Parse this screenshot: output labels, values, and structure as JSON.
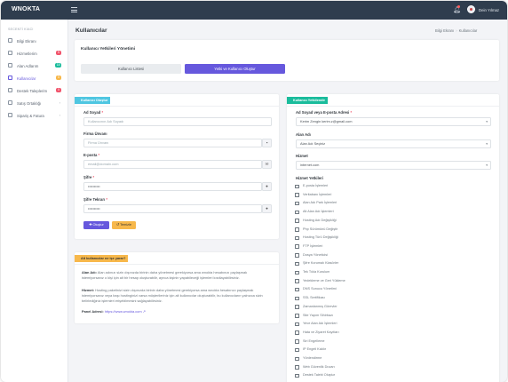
{
  "app": {
    "logo": "WNOKTA",
    "username": "Dein Yılmaz",
    "page_title": "Kullanıcılar"
  },
  "breadcrumb": {
    "home": "Bilgi Ekranı",
    "current": "Kullanıcılar"
  },
  "sidebar": {
    "section_title": "SECENTİ KİACI",
    "items": [
      {
        "label": "Bilgi Ekranı",
        "badge": "",
        "badge_color": ""
      },
      {
        "label": "Hizmetlerim",
        "badge": "9",
        "badge_color": "#f1556c"
      },
      {
        "label": "Alan Adlarım",
        "badge": "18",
        "badge_color": "#1abc9c"
      },
      {
        "label": "Kullanıcılar",
        "badge": "0",
        "badge_color": "#f7b84b"
      },
      {
        "label": "Destek Taleplerim",
        "badge": "0",
        "badge_color": "#f1556c"
      },
      {
        "label": "Satış Ortaklığı",
        "badge": "",
        "badge_color": ""
      },
      {
        "label": "Sipariş & Fatura",
        "badge": "",
        "badge_color": ""
      }
    ]
  },
  "top_card": {
    "title": "Kullanıcı Yetkileri Yönetimi",
    "tab_list": "Kullanıcı Listesi",
    "tab_create": "Yetki ve Kullanıcı Oluştur"
  },
  "create_form": {
    "header": "Kullanıcı Oluştur",
    "name_label": "Ad Soyad",
    "name_placeholder": "Kullanıcının Adı Soyadı",
    "company_label": "Firma Ünvanı",
    "company_placeholder": "Firma Ünvanı",
    "email_label": "E-posta",
    "email_placeholder": "email@domain.com",
    "password_label": "Şifre",
    "password_value": "••••••••••",
    "password_repeat_label": "Şifre Tekrarı",
    "password_repeat_value": "••••••••••",
    "btn_create": "✚ Oluştur",
    "btn_clear": "↺ Temizle"
  },
  "info_card": {
    "header": "Alt kullanıcılar ne işe yarar?",
    "p1_bold": "Alan Adı:",
    "p1": " Alan adınızı sizin dışınızda birinin daha yönetmesi gerekiyorsa ama wnokta hesabınızı paylaşmak istemiyorsanız o kişi için alt bir hesap oluşturabilir, ayrıca kişinin yapabileceği işlemleri kısıtlayabilirsiniz.",
    "p2_bold": "Hizmet:",
    "p2": " Hosting paketinizi sizin dışınızda birinin daha yönetmesi gerekiyorsa ama wnokta hesabınızı paylaşmak istemiyorsanız veya başı hostinginizi varsa müşterileriniz için alt kullanıcılar oluşturabilir, bu kullanıcıların yalnızca sizin belirlediğiniz işlemleri erişebilmesini sağlayabilirsiniz.",
    "panel_label": "Panel Adresi:",
    "panel_url": "https://www.wnokta.com"
  },
  "permissions_form": {
    "header": "Kullanıcı Yetkilendir",
    "user_label": "Ad Soyad veya E-posta Adresi",
    "user_value": "Kerim Zengin kerim.z@gmail.com",
    "domain_label": "Alan Adı",
    "domain_value": "Alan Adı Seçiniz",
    "service_label": "Hizmet",
    "service_value": "internet.com",
    "perms_label": "Hizmet Yetkileri",
    "perms": [
      "E-posta İşlemleri",
      "Veritabanı İşlemleri",
      "Alan Adı Park İşlemleri",
      "Alt Alan Adı İşlemleri",
      "Hosting Adı Değişikliği",
      "Php Sürümünü Değiştir",
      "Hosting Türü Değişikliği",
      "FTP İşlemleri",
      "Dosya Yöneticisi",
      "Şifre Korumalı Klasörler",
      "Tek Tıkla Kurulum",
      "Yedekleme ve Geri Yükleme",
      "DNS Sunucu Yönetimi",
      "SSL Sertifikası",
      "Zamanlanmış Görevler",
      "Site Yapım Sihirbazı",
      "Yeve Alan Adı İşlemleri",
      "Hata ve Ziyaret Kayıtları",
      "Siri Engelleme",
      "IP Engeli Kaldır",
      "Yönlendirme",
      "Web Güvenlik Duvarı",
      "Destek Talebi Oluştur"
    ]
  },
  "colors": {
    "topbar": "#2f3d4e",
    "accent": "#6658dd",
    "cyan": "#4fc6e1",
    "green": "#1abc9c",
    "yellow": "#f7b84b",
    "red": "#f1556c"
  },
  "icons": {
    "menu": "hamburger-icon",
    "bell": "bell-icon",
    "caret": "chevron-down-icon"
  }
}
